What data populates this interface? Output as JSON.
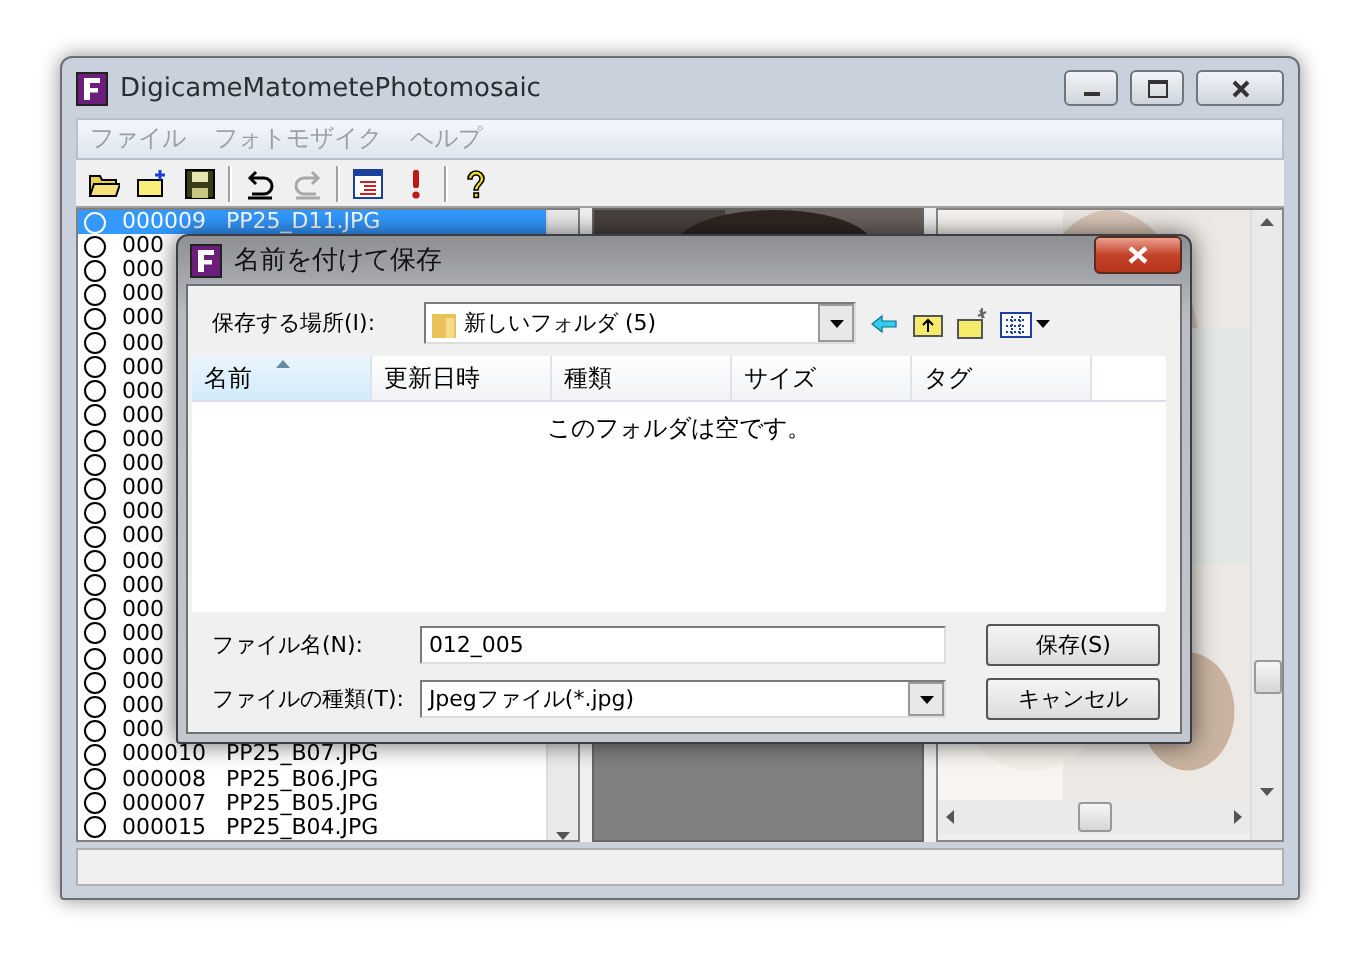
{
  "window": {
    "title": "DigicameMatometePhotomosaic"
  },
  "menu": [
    "ファイル",
    "フォトモザイク",
    "ヘルプ"
  ],
  "toolbar": [
    {
      "kind": "open"
    },
    {
      "kind": "newfolder"
    },
    {
      "kind": "save"
    },
    {
      "kind": "sep"
    },
    {
      "kind": "undo",
      "disabled": false
    },
    {
      "kind": "redo",
      "disabled": true
    },
    {
      "kind": "sep"
    },
    {
      "kind": "list"
    },
    {
      "kind": "run"
    },
    {
      "kind": "sep"
    },
    {
      "kind": "help"
    }
  ],
  "file_list": {
    "rows": [
      {
        "code": "000009",
        "name": "PP25_D11.JPG",
        "selected": true
      },
      {
        "code": "000",
        "selected": false
      },
      {
        "code": "000",
        "selected": false
      },
      {
        "code": "000",
        "selected": false
      },
      {
        "code": "000",
        "selected": false
      },
      {
        "code": "000",
        "selected": false
      },
      {
        "code": "000",
        "selected": false
      },
      {
        "code": "000",
        "selected": false
      },
      {
        "code": "000",
        "selected": false
      },
      {
        "code": "000",
        "selected": false
      },
      {
        "code": "000",
        "selected": false
      },
      {
        "code": "000",
        "selected": false
      },
      {
        "code": "000",
        "selected": false
      },
      {
        "code": "000",
        "selected": false
      },
      {
        "code": "000",
        "selected": false
      },
      {
        "code": "000",
        "selected": false
      },
      {
        "code": "000",
        "selected": false
      },
      {
        "code": "000",
        "selected": false
      },
      {
        "code": "000",
        "selected": false
      },
      {
        "code": "000",
        "selected": false
      },
      {
        "code": "000",
        "selected": false
      },
      {
        "code": "000",
        "selected": false
      },
      {
        "code": "000010",
        "name": "PP25_B07.JPG",
        "selected": false
      },
      {
        "code": "000008",
        "name": "PP25_B06.JPG",
        "selected": false
      },
      {
        "code": "000007",
        "name": "PP25_B05.JPG",
        "selected": false
      },
      {
        "code": "000015",
        "name": "PP25_B04.JPG",
        "selected": false
      }
    ]
  },
  "dialog": {
    "title": "名前を付けて保存",
    "location_label": "保存する場所(I):",
    "location": "新しいフォルダ (5)",
    "columns": [
      {
        "label": "名前",
        "sorted": true
      },
      {
        "label": "更新日時",
        "sorted": false
      },
      {
        "label": "種類",
        "sorted": false
      },
      {
        "label": "サイズ",
        "sorted": false
      },
      {
        "label": "タグ",
        "sorted": false
      }
    ],
    "empty_message": "このフォルダは空です。",
    "filename_label": "ファイル名(N):",
    "filename": "012_005",
    "filetype_label": "ファイルの種類(T):",
    "filetype": "Jpegファイル(*.jpg)",
    "buttons": [
      "保存(S)",
      "キャンセル"
    ]
  }
}
